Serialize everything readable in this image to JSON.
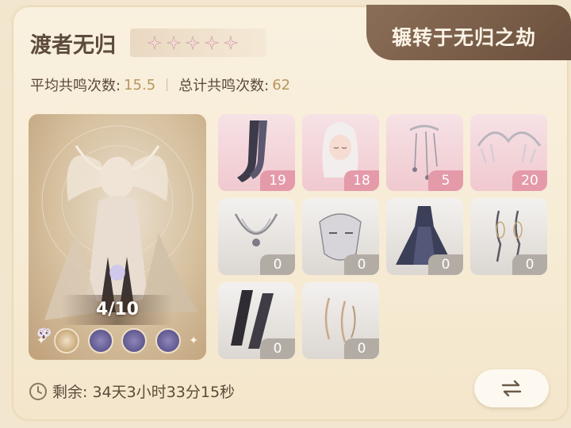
{
  "header": {
    "title": "渡者无归",
    "tab_label": "辗转于无归之劫",
    "star_count": 5
  },
  "stats": {
    "avg_label": "平均共鸣次数:",
    "avg_value": "15.5",
    "total_label": "总计共鸣次数:",
    "total_value": "62"
  },
  "portrait": {
    "progress": "4/10",
    "skills": [
      "key-icon",
      "infinity-icon",
      "infinity-icon",
      "clover-icon"
    ]
  },
  "items": [
    {
      "name": "stockings",
      "count": "19",
      "style": "pink"
    },
    {
      "name": "hairstyle",
      "count": "18",
      "style": "pink"
    },
    {
      "name": "hair-ornament",
      "count": "5",
      "style": "pink"
    },
    {
      "name": "headpiece",
      "count": "20",
      "style": "pink"
    },
    {
      "name": "necklace",
      "count": "0",
      "style": "gray"
    },
    {
      "name": "mask",
      "count": "0",
      "style": "gray"
    },
    {
      "name": "dress",
      "count": "0",
      "style": "gray"
    },
    {
      "name": "earrings",
      "count": "0",
      "style": "gray"
    },
    {
      "name": "gloves",
      "count": "0",
      "style": "gray"
    },
    {
      "name": "bracelet",
      "count": "0",
      "style": "gray"
    }
  ],
  "timer": {
    "label": "剩余: 34天3小时33分15秒"
  },
  "colors": {
    "accent_gold": "#b8965e",
    "tab_brown": "#7a5e49",
    "pink_badge": "#e59aa9",
    "gray_badge": "#b3aca5"
  }
}
